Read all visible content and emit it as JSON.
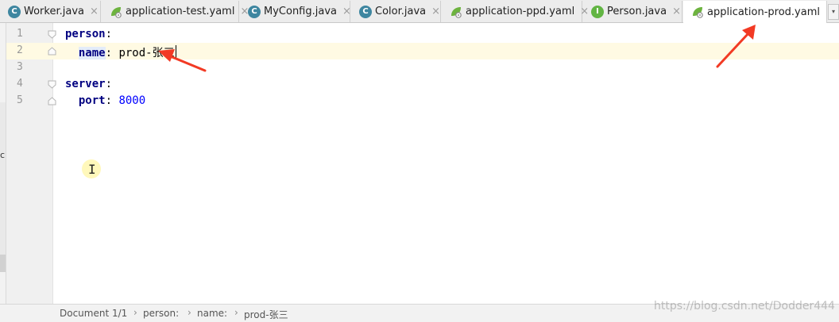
{
  "tabs": [
    {
      "label": "Worker.java",
      "icon": "class-icon"
    },
    {
      "label": "application-test.yaml",
      "icon": "spring-yaml-icon"
    },
    {
      "label": "MyConfig.java",
      "icon": "class-icon"
    },
    {
      "label": "Color.java",
      "icon": "class-icon"
    },
    {
      "label": "application-ppd.yaml",
      "icon": "spring-yaml-icon"
    },
    {
      "label": "Person.java",
      "icon": "interface-icon"
    },
    {
      "label": "application-prod.yaml",
      "icon": "spring-yaml-icon",
      "active": true
    }
  ],
  "tab_close_glyph": "×",
  "icon_letters": {
    "class": "C",
    "interface": "I"
  },
  "left_strip_char": "c",
  "editor": {
    "line_numbers": [
      "1",
      "2",
      "3",
      "4",
      "5"
    ],
    "lines": [
      {
        "key": "person",
        "colon": ":"
      },
      {
        "indent": "  ",
        "key": "name",
        "colon": ":",
        "value": " prod-张三"
      },
      {},
      {
        "key": "server",
        "colon": ":"
      },
      {
        "indent": "  ",
        "key": "port",
        "colon": ":",
        "value": " 8000"
      }
    ],
    "mouse_cursor_glyph": "I"
  },
  "breadcrumb": {
    "doc": "Document 1/1",
    "items": [
      "person:",
      "name:",
      "prod-张三"
    ],
    "separator": "›"
  },
  "watermark": "https://blog.csdn.net/Dodder444",
  "colors": {
    "key": "#000080",
    "number": "#0000ff",
    "current_line": "#fffae3",
    "class_icon": "#3e86a0",
    "interface_icon": "#62b543",
    "spring_leaf": "#6db33f",
    "annotation_arrow": "#f23a24"
  }
}
